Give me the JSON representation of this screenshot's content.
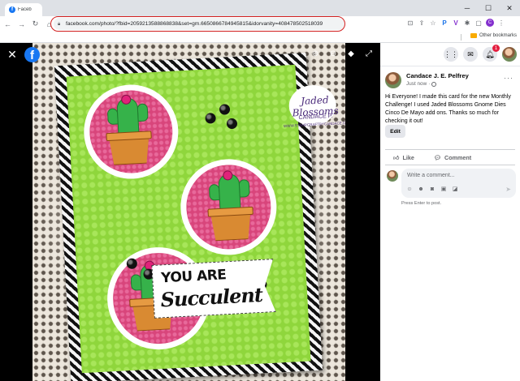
{
  "browser": {
    "tab_title": "Faceb",
    "url": "facebook.com/photo/?fbid=2059213588868838&set=gm.6650866784945815&idorvanity=408478502518039",
    "other_bookmarks": "Other bookmarks",
    "profile_initial": "C"
  },
  "viewer": {
    "banner_line1": "YOU ARE",
    "banner_line2": "Succulent",
    "watermark_brand": "Jaded Blossoms",
    "watermark_name": "CANDACE P.",
    "watermark_url": "WWW.STAMPCRAFTBYCANDACE.COM"
  },
  "sidebar": {
    "notification_count": "1",
    "post": {
      "author": "Candace J. E. Pelfrey",
      "time": "Just now",
      "time_sep": "·",
      "text": "Hi Everyone! I made this card for the new Monthly Challenge! I used Jaded Blossoms Gnome Dies Cinco De Mayo add ons. Thanks so much for checking it out!",
      "edit_label": "Edit",
      "like_label": "Like",
      "comment_label": "Comment"
    },
    "comment_box": {
      "placeholder": "Write a comment...",
      "hint": "Press Enter to post."
    }
  }
}
